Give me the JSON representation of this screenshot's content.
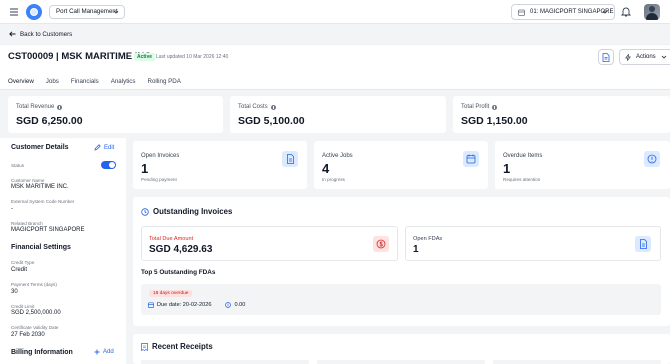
{
  "topbar": {
    "module": "Port Call Management",
    "branch": "01: MAGICPORT SINGAPORE"
  },
  "nav": {
    "back_label": "Back to Customers"
  },
  "customer": {
    "title": "CST00009 | MSK MARITIME INC.",
    "status_badge": "Active",
    "last_updated": "Last updated 10 Mar 2026 12:40",
    "actions_label": "Actions"
  },
  "tabs": [
    {
      "label": "Overview",
      "active": true
    },
    {
      "label": "Jobs"
    },
    {
      "label": "Financials"
    },
    {
      "label": "Analytics"
    },
    {
      "label": "Rolling PDA"
    }
  ],
  "kpis": [
    {
      "label": "Total Revenue",
      "value": "SGD 6,250.00"
    },
    {
      "label": "Total Costs",
      "value": "SGD 5,100.00"
    },
    {
      "label": "Total Profit",
      "value": "SGD 1,150.00"
    }
  ],
  "customer_details": {
    "heading": "Customer Details",
    "edit_label": "Edit",
    "status_label": "Status",
    "status_on": true,
    "name_label": "Customer Name",
    "name_value": "MSK MARITIME INC.",
    "ext_code_label": "External System Code Number",
    "ext_code_value": "-",
    "branch_label": "Related Branch",
    "branch_value": "MAGICPORT SINGAPORE"
  },
  "financial_settings": {
    "heading": "Financial Settings",
    "credit_type_label": "Credit Type",
    "credit_type_value": "Credit",
    "payment_terms_label": "Payment Terms (days)",
    "payment_terms_value": "30",
    "credit_limit_label": "Credit Limit",
    "credit_limit_value": "SGD 2,500,000.00",
    "cert_validity_label": "Certificate Validity Date",
    "cert_validity_value": "27 Feb 2030"
  },
  "billing": {
    "heading": "Billing Information",
    "add_label": "Add"
  },
  "stats": [
    {
      "label": "Open Invoices",
      "value": "1",
      "sub": "Pending payment"
    },
    {
      "label": "Active Jobs",
      "value": "4",
      "sub": "In progress"
    },
    {
      "label": "Overdue Items",
      "value": "1",
      "sub": "Requires attention"
    }
  ],
  "outstanding": {
    "heading": "Outstanding Invoices",
    "total_due_label": "Total Due Amount",
    "total_due_value": "SGD 4,629.63",
    "open_fdas_label": "Open FDAs",
    "open_fdas_value": "1",
    "top_fdas_heading": "Top 5 Outstanding FDAs",
    "fda": {
      "overdue_badge": "18 days overdue",
      "due_date": "Due date: 20-02-2026",
      "amount": "0.00"
    }
  },
  "receipts": {
    "heading": "Recent Receipts"
  },
  "colors": {
    "accent": "#2563eb",
    "danger": "#dc2626",
    "success": "#15803d"
  }
}
